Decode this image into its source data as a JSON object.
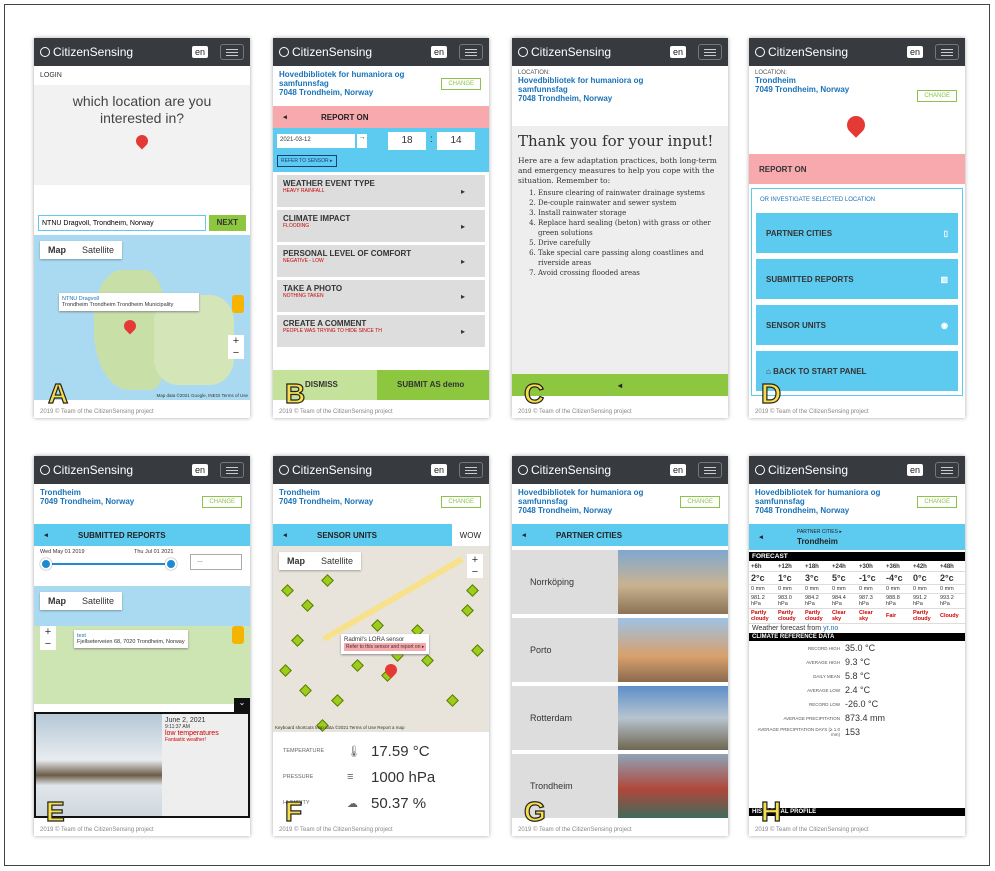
{
  "app": {
    "brand": "CitizenSensing",
    "lang": "en",
    "footer": "2019 © Team of the CitizenSensing project"
  },
  "a": {
    "letter": "A",
    "login": "LOGIN",
    "question": "which location are you interested in?",
    "input_value": "NTNU Dragvoll, Trondheim, Norway",
    "next": "NEXT",
    "map": "Map",
    "satellite": "Satellite",
    "popup_title": "NTNU Dragvoll",
    "popup_addr": "Trondheim Trondheim Trondheim Municipality",
    "attr": "Map data ©2021 Google, INEGI  Terms of Use"
  },
  "b": {
    "letter": "B",
    "loc_name": "Hovedbibliotek for humaniora og samfunnsfag",
    "loc_city": "7048 Trondheim, Norway",
    "change": "CHANGE",
    "report_on": "REPORT ON",
    "date": "2021-03-12",
    "hour": "18",
    "minute": "14",
    "refer": "REFER TO SENSOR ▸",
    "items": [
      {
        "title": "WEATHER EVENT TYPE",
        "sub": "HEAVY RAINFALL"
      },
      {
        "title": "CLIMATE IMPACT",
        "sub": "FLOODING"
      },
      {
        "title": "PERSONAL LEVEL OF COMFORT",
        "sub": "NEGATIVE - LOW"
      },
      {
        "title": "TAKE A PHOTO",
        "sub": "NOTHING TAKEN"
      },
      {
        "title": "CREATE A COMMENT",
        "sub": "PEOPLE WAS TRYING TO HIDE SINCE TH"
      }
    ],
    "dismiss": "DISMISS",
    "submit": "SUBMIT AS demo"
  },
  "c": {
    "letter": "C",
    "loc_label": "LOCATION:",
    "loc_name": "Hovedbibliotek for humaniora og samfunnsfag",
    "loc_city": "7048 Trondheim, Norway",
    "heading": "Thank you for your input!",
    "intro": "Here are a few adaptation practices, both long-term and emergency measures to help you cope with the situation. Remember to:",
    "list": [
      "Ensure clearing of rainwater drainage systems",
      "De-couple rainwater and sewer system",
      "Install rainwater storage",
      "Replace hard sealing (beton) with grass or other green solutions",
      "Drive carefully",
      "Take special care passing along coastlines and riverside areas",
      "Avoid crossing flooded areas"
    ]
  },
  "d": {
    "letter": "D",
    "loc_label": "LOCATION:",
    "loc_name": "Trondheim",
    "loc_city": "7049 Trondheim, Norway",
    "change": "CHANGE",
    "report_on": "REPORT ON",
    "investigate": "OR INVESTIGATE SELECTED LOCATION",
    "tiles": [
      "PARTNER CITIES",
      "SUBMITTED REPORTS",
      "SENSOR UNITS"
    ],
    "back": "BACK TO START PANEL"
  },
  "e": {
    "letter": "E",
    "loc_name": "Trondheim",
    "loc_city": "7049 Trondheim, Norway",
    "change": "CHANGE",
    "title": "SUBMITTED REPORTS",
    "date_start": "Wed May 01 2019",
    "date_end": "Thu Jul 01 2021",
    "select": "...",
    "map": "Map",
    "satellite": "Satellite",
    "popup_title": "test",
    "popup_addr": "Fjellseterveien 68, 7020 Trondheim, Norway",
    "report_date": "June 2, 2021",
    "report_time": "9:11:37 AM",
    "report_title": "low temperatures",
    "report_note": "Fantastic weather!"
  },
  "f": {
    "letter": "F",
    "loc_name": "Trondheim",
    "loc_city": "7049 Trondheim, Norway",
    "change": "CHANGE",
    "title": "SENSOR UNITS",
    "wow": "WOW",
    "map": "Map",
    "satellite": "Satellite",
    "sensor_name": "Radmil's LORA sensor",
    "sensor_link": "Refer to this sensor and report on ▸",
    "attr": "Keyboard shortcuts  Map data ©2021  Terms of Use  Report a map",
    "readings": [
      {
        "label": "TEMPERATURE",
        "value": "17.59 °C"
      },
      {
        "label": "PRESSURE",
        "value": "1000 hPa"
      },
      {
        "label": "HUMIDITY",
        "value": "50.37 %"
      }
    ]
  },
  "g": {
    "letter": "G",
    "loc_name": "Hovedbibliotek for humaniora og samfunnsfag",
    "loc_city": "7048 Trondheim, Norway",
    "change": "CHANGE",
    "title": "PARTNER CITIES",
    "cities": [
      "Norrköping",
      "Porto",
      "Rotterdam",
      "Trondheim"
    ]
  },
  "h": {
    "letter": "H",
    "loc_name": "Hovedbibliotek for humaniora og samfunnsfag",
    "loc_city": "7048 Trondheim, Norway",
    "change": "CHANGE",
    "crumb": "PARTNER CITIES ▸",
    "city": "Trondheim",
    "forecast": "FORECAST",
    "hours": [
      "+6h",
      "+12h",
      "+18h",
      "+24h",
      "+30h",
      "+36h",
      "+42h",
      "+48h"
    ],
    "temps": [
      "2°c",
      "1°c",
      "3°c",
      "5°c",
      "-1°c",
      "-4°c",
      "0°c",
      "2°c"
    ],
    "precip": [
      "0 mm",
      "0 mm",
      "0 mm",
      "0 mm",
      "0 mm",
      "0 mm",
      "0 mm",
      "0 mm"
    ],
    "pressure": [
      "981.2 hPa",
      "983.0 hPa",
      "984.2 hPa",
      "984.4 hPa",
      "987.3 hPa",
      "988.8 hPa",
      "991.2 hPa",
      "993.2 hPa"
    ],
    "sky": [
      "Partly cloudy",
      "Partly cloudy",
      "Partly cloudy",
      "Clear sky",
      "Clear sky",
      "Fair",
      "Partly cloudy",
      "Cloudy"
    ],
    "source_text": "Weather forecast from",
    "source_link": "yr.no",
    "climate": "CLIMATE REFERENCE DATA",
    "climate_rows": [
      {
        "k": "RECORD HIGH",
        "v": "35.0 °C"
      },
      {
        "k": "AVERAGE HIGH",
        "v": "9.3 °C"
      },
      {
        "k": "DAILY MEAN",
        "v": "5.8 °C"
      },
      {
        "k": "AVERAGE LOW",
        "v": "2.4 °C"
      },
      {
        "k": "RECORD LOW",
        "v": "-26.0 °C"
      },
      {
        "k": "AVERAGE PRECIPITATION",
        "v": "873.4 mm"
      },
      {
        "k": "AVERAGE PRECIPITATION DAYS (≥ 1.0 mm)",
        "v": "153"
      }
    ],
    "historical": "HISTORICAL PROFILE"
  }
}
